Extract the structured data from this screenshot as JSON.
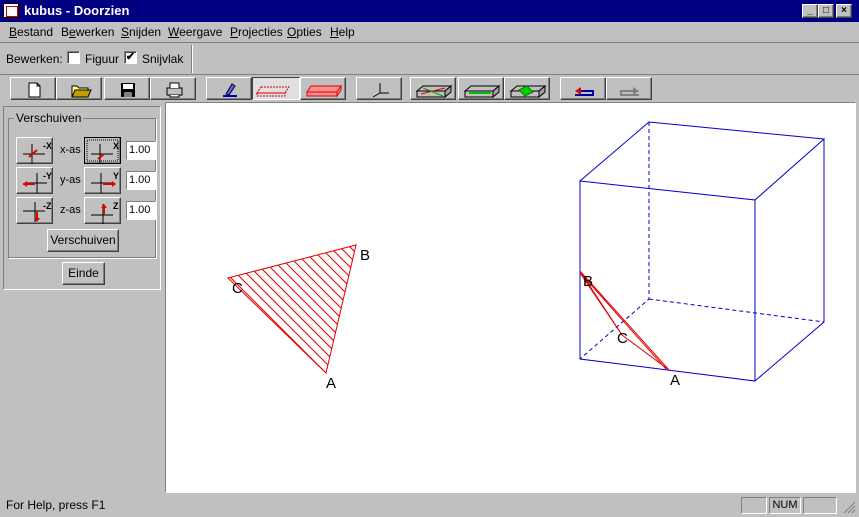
{
  "window": {
    "title": "kubus - Doorzien",
    "controls": [
      "_",
      "□",
      "×"
    ]
  },
  "menu": [
    {
      "label": "Bestand",
      "key": "B"
    },
    {
      "label": "Bewerken",
      "key": "e"
    },
    {
      "label": "Snijden",
      "key": "S"
    },
    {
      "label": "Weergave",
      "key": "W"
    },
    {
      "label": "Projecties",
      "key": "P"
    },
    {
      "label": "Opties",
      "key": "O"
    },
    {
      "label": "Help",
      "key": "H"
    }
  ],
  "editbar": {
    "label": "Bewerken:",
    "figuur": {
      "label": "Figuur",
      "checked": false
    },
    "snijvlak": {
      "label": "Snijvlak",
      "checked": true
    }
  },
  "toolbar": {
    "icons": [
      "new-file-icon",
      "open-folder-icon",
      "save-icon",
      "print-icon",
      "draw-figure-icon",
      "cut-plane-icon",
      "cut-plane-red-icon",
      "axes-icon",
      "slab-red-icon",
      "slab-green-icon",
      "slab-green-fill-icon",
      "undo-icon",
      "redo-icon"
    ]
  },
  "panel": {
    "group_title": "Verschuiven",
    "rows": [
      {
        "axis_label": "x-as",
        "neg": "-X",
        "pos": "X",
        "value": "1.00"
      },
      {
        "axis_label": "y-as",
        "neg": "-Y",
        "pos": "Y",
        "value": "1.00"
      },
      {
        "axis_label": "z-as",
        "neg": "-Z",
        "pos": "Z",
        "value": "1.00"
      }
    ],
    "move_button": "Verschuiven",
    "end_button": "Einde"
  },
  "drawing": {
    "triangle_labels": {
      "A": "A",
      "B": "B",
      "C": "C"
    },
    "cube_labels": {
      "A": "A",
      "B": "B",
      "C": "C"
    },
    "colors": {
      "cube": "#0000cc",
      "section": "#e00000"
    }
  },
  "status": {
    "help_text": "For Help, press F1",
    "num": "NUM"
  }
}
